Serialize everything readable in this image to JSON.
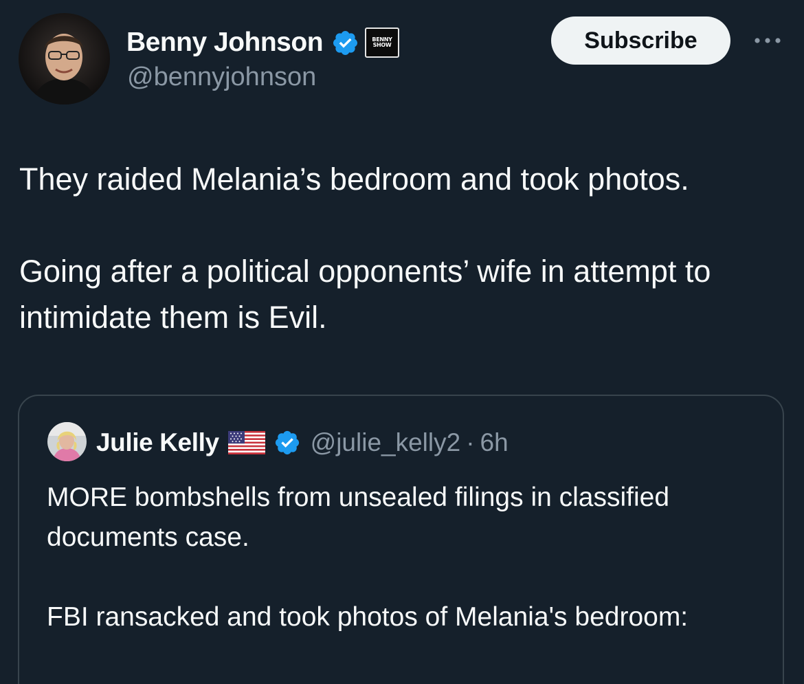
{
  "author": {
    "name": "Benny Johnson",
    "handle": "@bennyjohnson",
    "verified": true,
    "badge_text_line1": "BENNY",
    "badge_text_line2": "SHOW"
  },
  "subscribe_label": "Subscribe",
  "more_icon": "more-horizontal-icon",
  "tweet": {
    "paragraphs": [
      "They raided Melania’s bedroom and took photos.",
      "Going after a political opponents’ wife in attempt to intimidate them is Evil."
    ]
  },
  "quote": {
    "name": "Julie Kelly",
    "flag_icon": "us-flag-icon",
    "verified": true,
    "handle": "@julie_kelly2",
    "separator": "·",
    "time": "6h",
    "paragraphs": [
      "MORE bombshells from unsealed filings in classified documents case.",
      "FBI ransacked and took photos of Melania's bedroom:"
    ]
  },
  "colors": {
    "background": "#15202b",
    "text_primary": "#f7f9f9",
    "text_secondary": "#8b98a5",
    "verified_blue": "#1d9bf0",
    "card_border": "#38444d",
    "button_bg": "#eff3f4"
  }
}
